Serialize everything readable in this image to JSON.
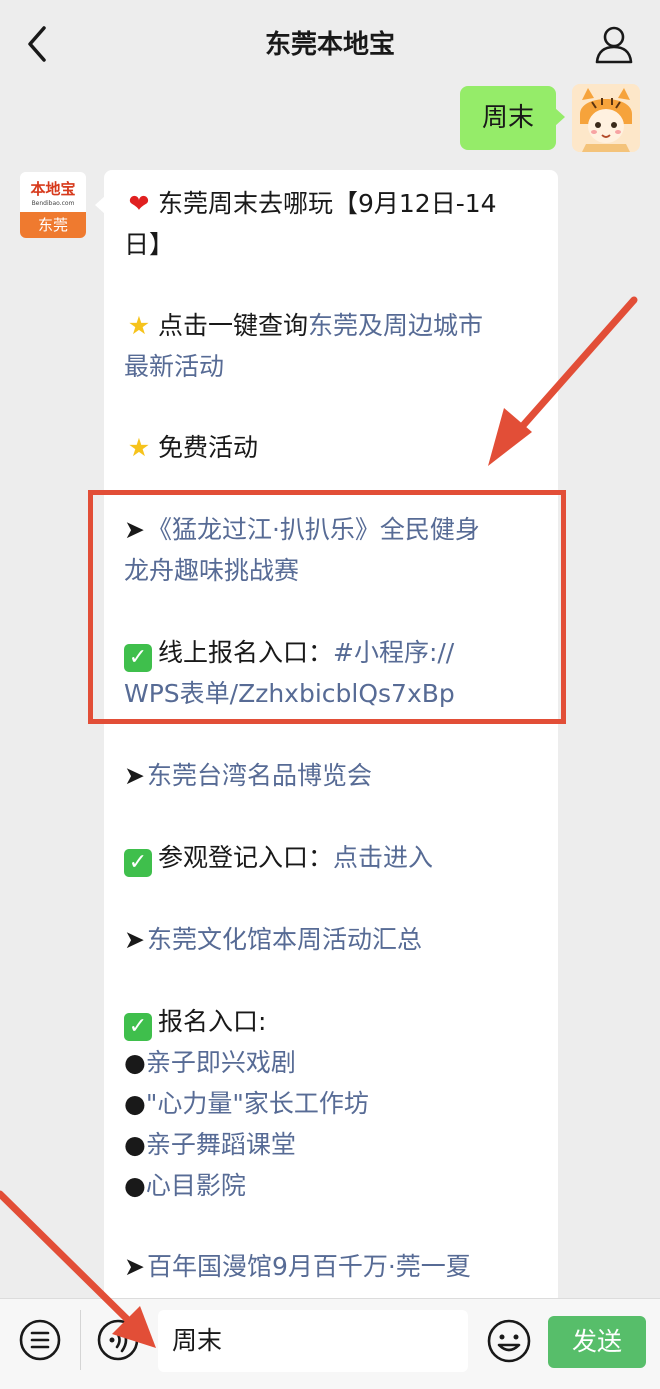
{
  "header": {
    "title": "东莞本地宝"
  },
  "outgoing": {
    "text": "周末"
  },
  "bot_avatar": {
    "logo": "本地宝",
    "domain": "Bendibao.com",
    "city": "东莞"
  },
  "message": {
    "title": "东莞周末去哪玩【9月12日-14",
    "title_cont": "日】",
    "query_prefix": "点击一键查询",
    "query_link_1": "东莞及周边城市",
    "query_link_2": "最新活动",
    "free_label": "免费活动",
    "event1_title_1": "《猛龙过江·扒扒乐》全民健身",
    "event1_title_2": "龙舟趣味挑战赛",
    "event1_entry_label": "线上报名入口：",
    "event1_entry_link_1": "#小程序://",
    "event1_entry_link_2": "WPS表单/ZzhxbicblQs7xBp",
    "event2_title": "东莞台湾名品博览会",
    "event2_entry_label": "参观登记入口：",
    "event2_entry_link": "点击进入",
    "event3_title": "东莞文化馆本周活动汇总",
    "event3_entry_label": "报名入口:",
    "event3_items": [
      "亲子即兴戏剧",
      "\"心力量\"家长工作坊",
      "亲子舞蹈课堂",
      "心目影院"
    ],
    "event4_title": "百年国漫馆9月百千万·莞一夏"
  },
  "input_bar": {
    "value": "周末",
    "send_label": "发送"
  },
  "icons": {
    "heart": "heart-icon",
    "star": "star-icon",
    "check": "check-icon",
    "arrow": "arrow-icon",
    "bullet": "bullet-icon"
  },
  "colors": {
    "link": "#576b95",
    "bubble_out": "#95ec69",
    "send": "#57be6a",
    "annotation": "#e24e37"
  }
}
